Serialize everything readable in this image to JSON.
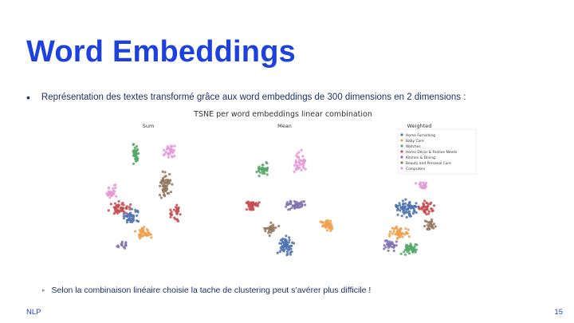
{
  "slide": {
    "title": "Word Embeddings",
    "bullet": "Représentation des textes transformé grâce aux word embeddings de 300 dimensions en 2 dimensions :",
    "sub_bullet": "Selon la combinaison linéaire choisie la tache de clustering peut s’avérer plus difficile !",
    "footer_left": "NLP",
    "page_number": "15"
  },
  "chart_data": {
    "type": "scatter",
    "title": "TSNE per word embeddings linear combination",
    "subplots": [
      {
        "name": "Sum"
      },
      {
        "name": "Mean"
      },
      {
        "name": "Weighted"
      }
    ],
    "legend": {
      "placement": "top-right",
      "entries": [
        {
          "label": "Home Furnishing",
          "color": "#4c72b0"
        },
        {
          "label": "Baby Care",
          "color": "#f0a04b"
        },
        {
          "label": "Watches",
          "color": "#55a868"
        },
        {
          "label": "Home Décor & Festive Needs",
          "color": "#c44e52"
        },
        {
          "label": "Kitchen & Dining",
          "color": "#8172b2"
        },
        {
          "label": "Beauty and Personal Care",
          "color": "#937860"
        },
        {
          "label": "Computers",
          "color": "#e59ad6"
        }
      ]
    }
  }
}
